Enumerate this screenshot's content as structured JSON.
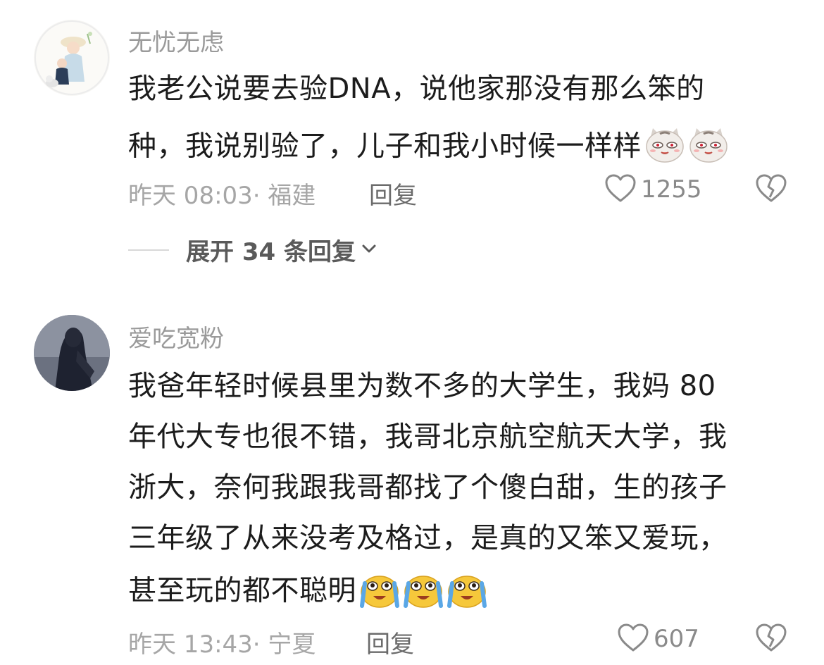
{
  "comments": [
    {
      "username": "无忧无虑",
      "lines": [
        "我老公说要去验DNA，说他家那没有那么笨的",
        "种，我说别验了，儿子和我小时候一样样"
      ],
      "emojis": [
        "cat-face-emoji",
        "cat-face-emoji"
      ],
      "time": "昨天 08:03",
      "location": "福建",
      "meta": "昨天 08:03· 福建",
      "reply_label": "回复",
      "likes": "1255",
      "expand_label": "展开 34 条回复"
    },
    {
      "username": "爱吃宽粉",
      "lines": [
        "我爸年轻时候县里为数不多的大学生，我妈 80",
        "年代大专也很不错，我哥北京航空航天大学，我",
        "浙大，奈何我跟我哥都找了个傻白甜，生的孩子",
        "三年级了从来没考及格过，是真的又笨又爱玩，",
        "甚至玩的都不聪明"
      ],
      "emojis": [
        "crying-face-emoji",
        "crying-face-emoji",
        "crying-face-emoji"
      ],
      "time": "昨天 13:43",
      "location": "宁夏",
      "meta": "昨天 13:43· 宁夏",
      "reply_label": "回复",
      "likes": "607"
    }
  ],
  "colors": {
    "username": "#9a9a9a",
    "text": "#1c1c1c",
    "meta": "#a6a6a6",
    "reply": "#6b6b6b",
    "emoji_yellow": "#f6c83b",
    "emoji_blue": "#5aa7e6"
  },
  "icons": {
    "like": "heart-outline-icon",
    "dislike": "broken-heart-icon",
    "expand": "chevron-down-icon"
  }
}
